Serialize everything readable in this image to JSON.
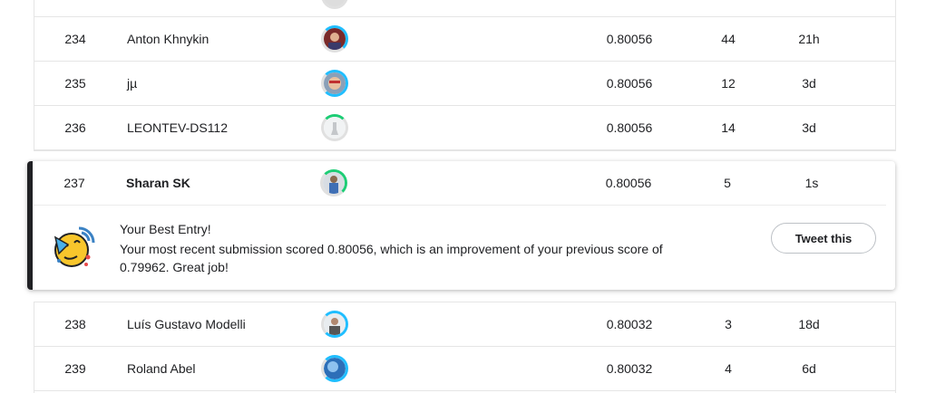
{
  "leaderboard": {
    "rows_above": [
      {
        "rank": "234",
        "name": "Anton Khnykin",
        "score": "0.80056",
        "entries": "44",
        "last": "21h",
        "avatar_icon": "user-avatar-photo",
        "ring_color": "#20beff"
      },
      {
        "rank": "235",
        "name": "jµ",
        "score": "0.80056",
        "entries": "12",
        "last": "3d",
        "avatar_icon": "user-avatar-photo",
        "ring_color": "#20beff"
      },
      {
        "rank": "236",
        "name": "LEONTEV-DS112",
        "score": "0.80056",
        "entries": "14",
        "last": "3d",
        "avatar_icon": "user-avatar-default",
        "ring_color": "#1dcd75"
      }
    ],
    "current_user": {
      "rank": "237",
      "name": "Sharan SK",
      "score": "0.80056",
      "entries": "5",
      "last": "1s",
      "avatar_icon": "user-avatar-photo",
      "ring_color": "#1dcd75"
    },
    "rows_below": [
      {
        "rank": "238",
        "name": "Luís Gustavo Modelli",
        "score": "0.80032",
        "entries": "3",
        "last": "18d",
        "avatar_icon": "user-avatar-photo",
        "ring_color": "#20beff"
      },
      {
        "rank": "239",
        "name": "Roland Abel",
        "score": "0.80032",
        "entries": "4",
        "last": "6d",
        "avatar_icon": "user-avatar-photo",
        "ring_color": "#20beff"
      }
    ]
  },
  "banner": {
    "icon": "party-face-icon",
    "title": "Your Best Entry!",
    "message": "Your most recent submission scored 0.80056, which is an improvement of your previous score of 0.79962. Great job!",
    "tweet_label": "Tweet this"
  }
}
